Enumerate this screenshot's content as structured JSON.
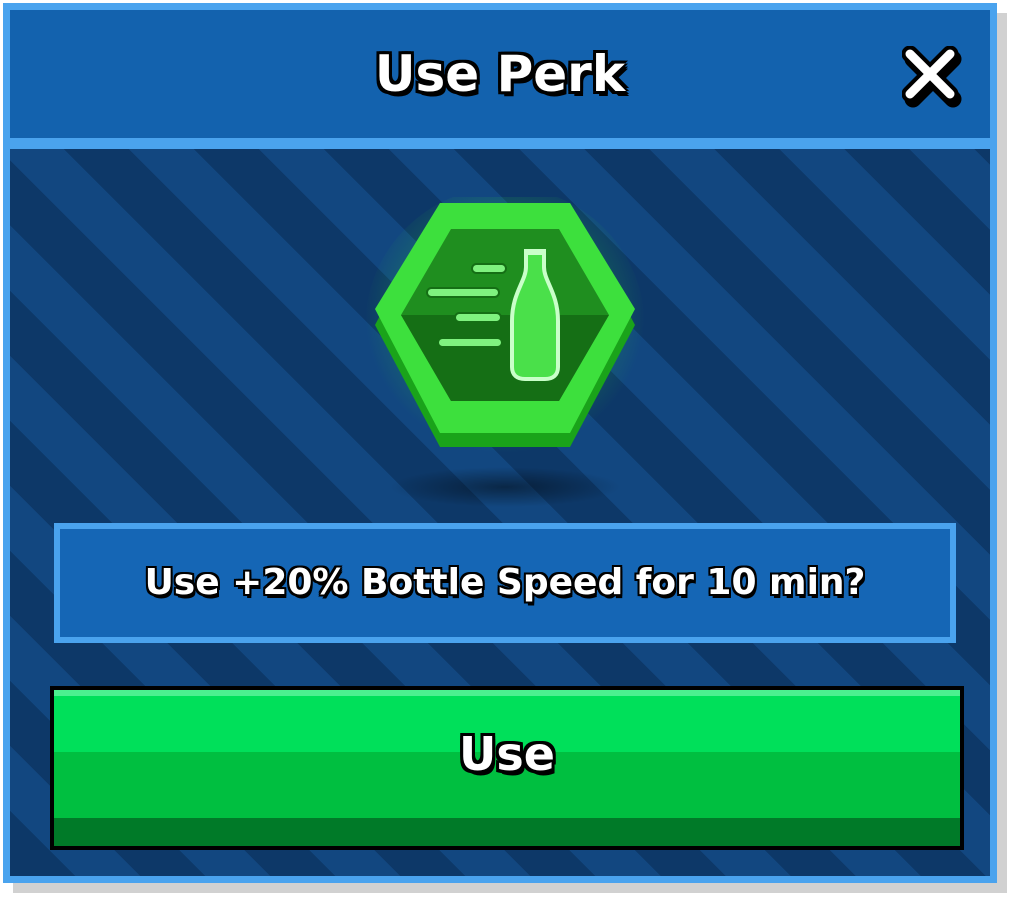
{
  "dialog": {
    "title": "Use Perk",
    "close_icon": "close-icon"
  },
  "perk": {
    "icon": "bottle-speed-icon",
    "badge_shape": "hexagon",
    "color": "#2fd62f"
  },
  "prompt": {
    "text": "Use +20% Bottle Speed for 10 min?"
  },
  "actions": {
    "use_label": "Use"
  },
  "colors": {
    "header": "#1362ae",
    "frame": "#4aa3ee",
    "button": "#00e05a"
  }
}
